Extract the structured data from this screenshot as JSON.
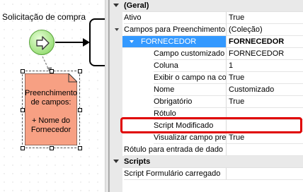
{
  "canvas": {
    "title": "Solicitação de compra",
    "task_node_text": [
      "Preenchimento",
      "de campos:",
      "",
      "+ Nome do",
      "Fornecedor"
    ],
    "task_fill_color": "#f7a083",
    "start_fill_color": "#9ee07d"
  },
  "property_grid": {
    "category_general": "(Geral)",
    "rows": {
      "ativo": {
        "name": "Ativo",
        "value": "True"
      },
      "campos": {
        "name": "Campos para Preenchimento",
        "value": "(Coleção)"
      },
      "fornecedor": {
        "name": "FORNECEDOR",
        "value": "FORNECEDOR"
      },
      "campo_customizado": {
        "name": "Campo customizado",
        "value": "FORNECEDOR"
      },
      "coluna": {
        "name": "Coluna",
        "value": "1"
      },
      "exibir": {
        "name": "Exibir o campo na co",
        "value": "True"
      },
      "nome": {
        "name": "Nome",
        "value": "Customizado"
      },
      "obrigatorio": {
        "name": "Obrigatório",
        "value": "True"
      },
      "rotulo": {
        "name": "Rótulo",
        "value": ""
      },
      "script_modificado": {
        "name": "Script Modificado",
        "value": ""
      },
      "visualizar": {
        "name": "Visualizar campo pre",
        "value": "True"
      },
      "rotulo_entrada": {
        "name": "Rótulo para entrada de dado",
        "value": ""
      }
    },
    "category_scripts": "Scripts",
    "script_rows": {
      "script_form": {
        "name": "Script Formulário carregado",
        "value": ""
      }
    },
    "selection_color": "#3399ff",
    "highlight_color": "#e00000"
  }
}
